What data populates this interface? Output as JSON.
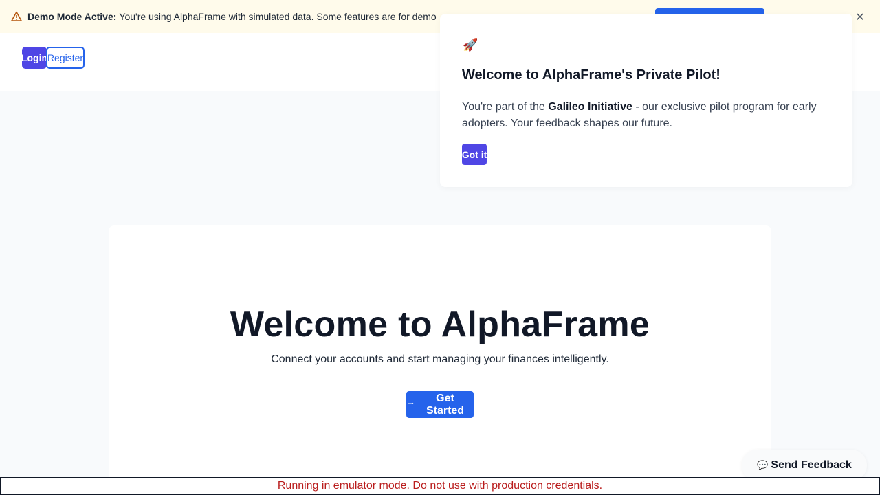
{
  "banner": {
    "title": "Demo Mode Active:",
    "message": "You're using AlphaFrame with simulated data. Some features are for demo",
    "icon": "warning-triangle-icon",
    "close_glyph": "✕"
  },
  "header": {
    "login_label": "Login",
    "register_label": "Register"
  },
  "pilot_popup": {
    "icon": "🚀",
    "title": "Welcome to AlphaFrame's Private Pilot!",
    "body_pre": "You're part of the ",
    "body_bold": "Galileo Initiative",
    "body_post": " - our exclusive pilot program for early adopters. Your feedback shapes our future.",
    "button_label": "Got it"
  },
  "hero": {
    "title": "Welcome to AlphaFrame",
    "subtitle": "Connect your accounts and start managing your finances intelligently.",
    "cta_label": "Get Started",
    "cta_icon": "→"
  },
  "feedback": {
    "icon": "💬",
    "label": "Send Feedback"
  },
  "emulator_notice": "Running in emulator mode. Do not use with production credentials.",
  "colors": {
    "banner_bg": "#fffbeb",
    "primary_indigo": "#4f46e5",
    "primary_blue": "#2563eb",
    "warning_red": "#b91c1c"
  }
}
